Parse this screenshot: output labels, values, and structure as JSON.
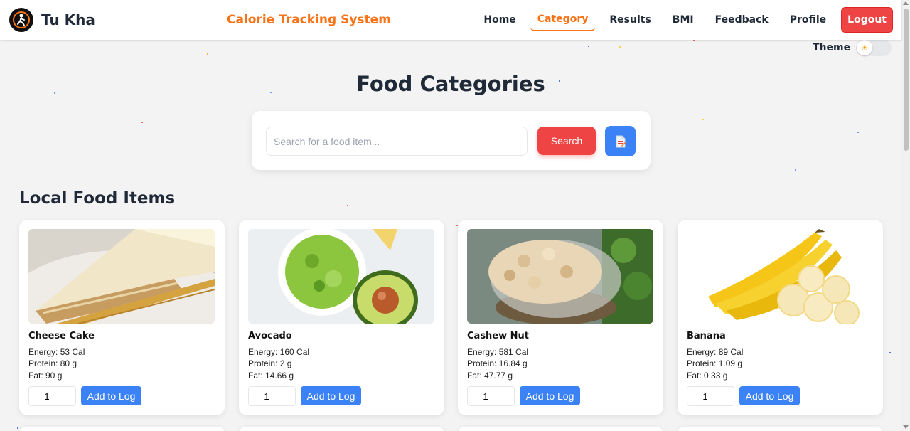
{
  "brand": {
    "name": "Tu Kha"
  },
  "header": {
    "title": "Calorie Tracking System"
  },
  "nav": {
    "items": [
      {
        "label": "Home"
      },
      {
        "label": "Category"
      },
      {
        "label": "Results"
      },
      {
        "label": "BMI"
      },
      {
        "label": "Feedback"
      },
      {
        "label": "Profile"
      }
    ],
    "active": "Category",
    "logout_label": "Logout"
  },
  "theme": {
    "label": "Theme"
  },
  "page": {
    "title": "Food Categories"
  },
  "search": {
    "placeholder": "Search for a food item...",
    "button_label": "Search"
  },
  "section": {
    "title": "Local Food Items"
  },
  "foods": [
    {
      "name": "Cheese Cake",
      "energy": "Energy: 53 Cal",
      "protein": "Protein: 80 g",
      "fat": "Fat: 90 g",
      "qty": "1",
      "add_label": "Add to Log"
    },
    {
      "name": "Avocado",
      "energy": "Energy: 160 Cal",
      "protein": "Protein: 2 g",
      "fat": "Fat: 14.66 g",
      "qty": "1",
      "add_label": "Add to Log"
    },
    {
      "name": "Cashew Nut",
      "energy": "Energy: 581 Cal",
      "protein": "Protein: 16.84 g",
      "fat": "Fat: 47.77 g",
      "qty": "1",
      "add_label": "Add to Log"
    },
    {
      "name": "Banana",
      "energy": "Energy: 89 Cal",
      "protein": "Protein: 1.09 g",
      "fat": "Fat: 0.33 g",
      "qty": "1",
      "add_label": "Add to Log"
    }
  ],
  "colors": {
    "accent": "#f97316",
    "danger": "#ef4444",
    "primary": "#3b82f6",
    "background": "#f3f3f3"
  }
}
